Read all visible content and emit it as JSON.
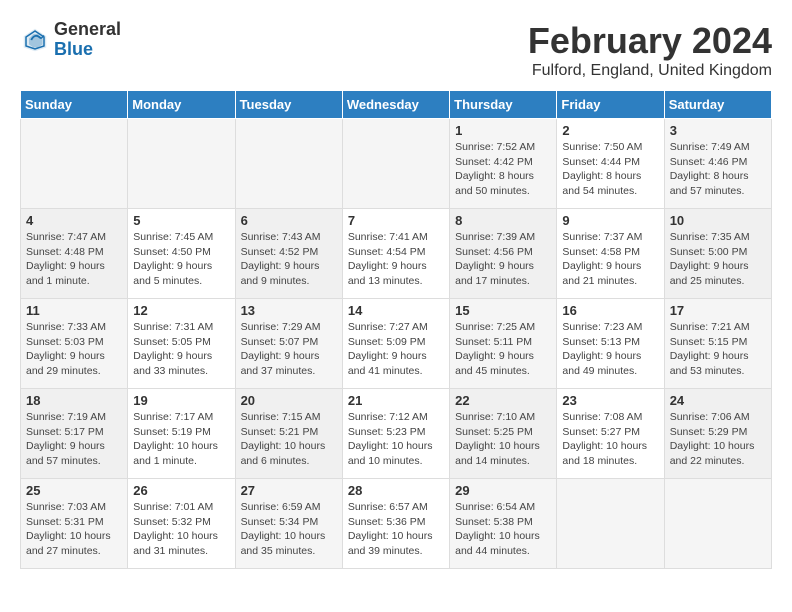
{
  "header": {
    "logo": {
      "general": "General",
      "blue": "Blue"
    },
    "title": "February 2024",
    "location": "Fulford, England, United Kingdom"
  },
  "calendar": {
    "days_of_week": [
      "Sunday",
      "Monday",
      "Tuesday",
      "Wednesday",
      "Thursday",
      "Friday",
      "Saturday"
    ],
    "weeks": [
      [
        {
          "day": "",
          "content": ""
        },
        {
          "day": "",
          "content": ""
        },
        {
          "day": "",
          "content": ""
        },
        {
          "day": "",
          "content": ""
        },
        {
          "day": "1",
          "content": "Sunrise: 7:52 AM\nSunset: 4:42 PM\nDaylight: 8 hours and 50 minutes."
        },
        {
          "day": "2",
          "content": "Sunrise: 7:50 AM\nSunset: 4:44 PM\nDaylight: 8 hours and 54 minutes."
        },
        {
          "day": "3",
          "content": "Sunrise: 7:49 AM\nSunset: 4:46 PM\nDaylight: 8 hours and 57 minutes."
        }
      ],
      [
        {
          "day": "4",
          "content": "Sunrise: 7:47 AM\nSunset: 4:48 PM\nDaylight: 9 hours and 1 minute."
        },
        {
          "day": "5",
          "content": "Sunrise: 7:45 AM\nSunset: 4:50 PM\nDaylight: 9 hours and 5 minutes."
        },
        {
          "day": "6",
          "content": "Sunrise: 7:43 AM\nSunset: 4:52 PM\nDaylight: 9 hours and 9 minutes."
        },
        {
          "day": "7",
          "content": "Sunrise: 7:41 AM\nSunset: 4:54 PM\nDaylight: 9 hours and 13 minutes."
        },
        {
          "day": "8",
          "content": "Sunrise: 7:39 AM\nSunset: 4:56 PM\nDaylight: 9 hours and 17 minutes."
        },
        {
          "day": "9",
          "content": "Sunrise: 7:37 AM\nSunset: 4:58 PM\nDaylight: 9 hours and 21 minutes."
        },
        {
          "day": "10",
          "content": "Sunrise: 7:35 AM\nSunset: 5:00 PM\nDaylight: 9 hours and 25 minutes."
        }
      ],
      [
        {
          "day": "11",
          "content": "Sunrise: 7:33 AM\nSunset: 5:03 PM\nDaylight: 9 hours and 29 minutes."
        },
        {
          "day": "12",
          "content": "Sunrise: 7:31 AM\nSunset: 5:05 PM\nDaylight: 9 hours and 33 minutes."
        },
        {
          "day": "13",
          "content": "Sunrise: 7:29 AM\nSunset: 5:07 PM\nDaylight: 9 hours and 37 minutes."
        },
        {
          "day": "14",
          "content": "Sunrise: 7:27 AM\nSunset: 5:09 PM\nDaylight: 9 hours and 41 minutes."
        },
        {
          "day": "15",
          "content": "Sunrise: 7:25 AM\nSunset: 5:11 PM\nDaylight: 9 hours and 45 minutes."
        },
        {
          "day": "16",
          "content": "Sunrise: 7:23 AM\nSunset: 5:13 PM\nDaylight: 9 hours and 49 minutes."
        },
        {
          "day": "17",
          "content": "Sunrise: 7:21 AM\nSunset: 5:15 PM\nDaylight: 9 hours and 53 minutes."
        }
      ],
      [
        {
          "day": "18",
          "content": "Sunrise: 7:19 AM\nSunset: 5:17 PM\nDaylight: 9 hours and 57 minutes."
        },
        {
          "day": "19",
          "content": "Sunrise: 7:17 AM\nSunset: 5:19 PM\nDaylight: 10 hours and 1 minute."
        },
        {
          "day": "20",
          "content": "Sunrise: 7:15 AM\nSunset: 5:21 PM\nDaylight: 10 hours and 6 minutes."
        },
        {
          "day": "21",
          "content": "Sunrise: 7:12 AM\nSunset: 5:23 PM\nDaylight: 10 hours and 10 minutes."
        },
        {
          "day": "22",
          "content": "Sunrise: 7:10 AM\nSunset: 5:25 PM\nDaylight: 10 hours and 14 minutes."
        },
        {
          "day": "23",
          "content": "Sunrise: 7:08 AM\nSunset: 5:27 PM\nDaylight: 10 hours and 18 minutes."
        },
        {
          "day": "24",
          "content": "Sunrise: 7:06 AM\nSunset: 5:29 PM\nDaylight: 10 hours and 22 minutes."
        }
      ],
      [
        {
          "day": "25",
          "content": "Sunrise: 7:03 AM\nSunset: 5:31 PM\nDaylight: 10 hours and 27 minutes."
        },
        {
          "day": "26",
          "content": "Sunrise: 7:01 AM\nSunset: 5:32 PM\nDaylight: 10 hours and 31 minutes."
        },
        {
          "day": "27",
          "content": "Sunrise: 6:59 AM\nSunset: 5:34 PM\nDaylight: 10 hours and 35 minutes."
        },
        {
          "day": "28",
          "content": "Sunrise: 6:57 AM\nSunset: 5:36 PM\nDaylight: 10 hours and 39 minutes."
        },
        {
          "day": "29",
          "content": "Sunrise: 6:54 AM\nSunset: 5:38 PM\nDaylight: 10 hours and 44 minutes."
        },
        {
          "day": "",
          "content": ""
        },
        {
          "day": "",
          "content": ""
        }
      ]
    ]
  }
}
